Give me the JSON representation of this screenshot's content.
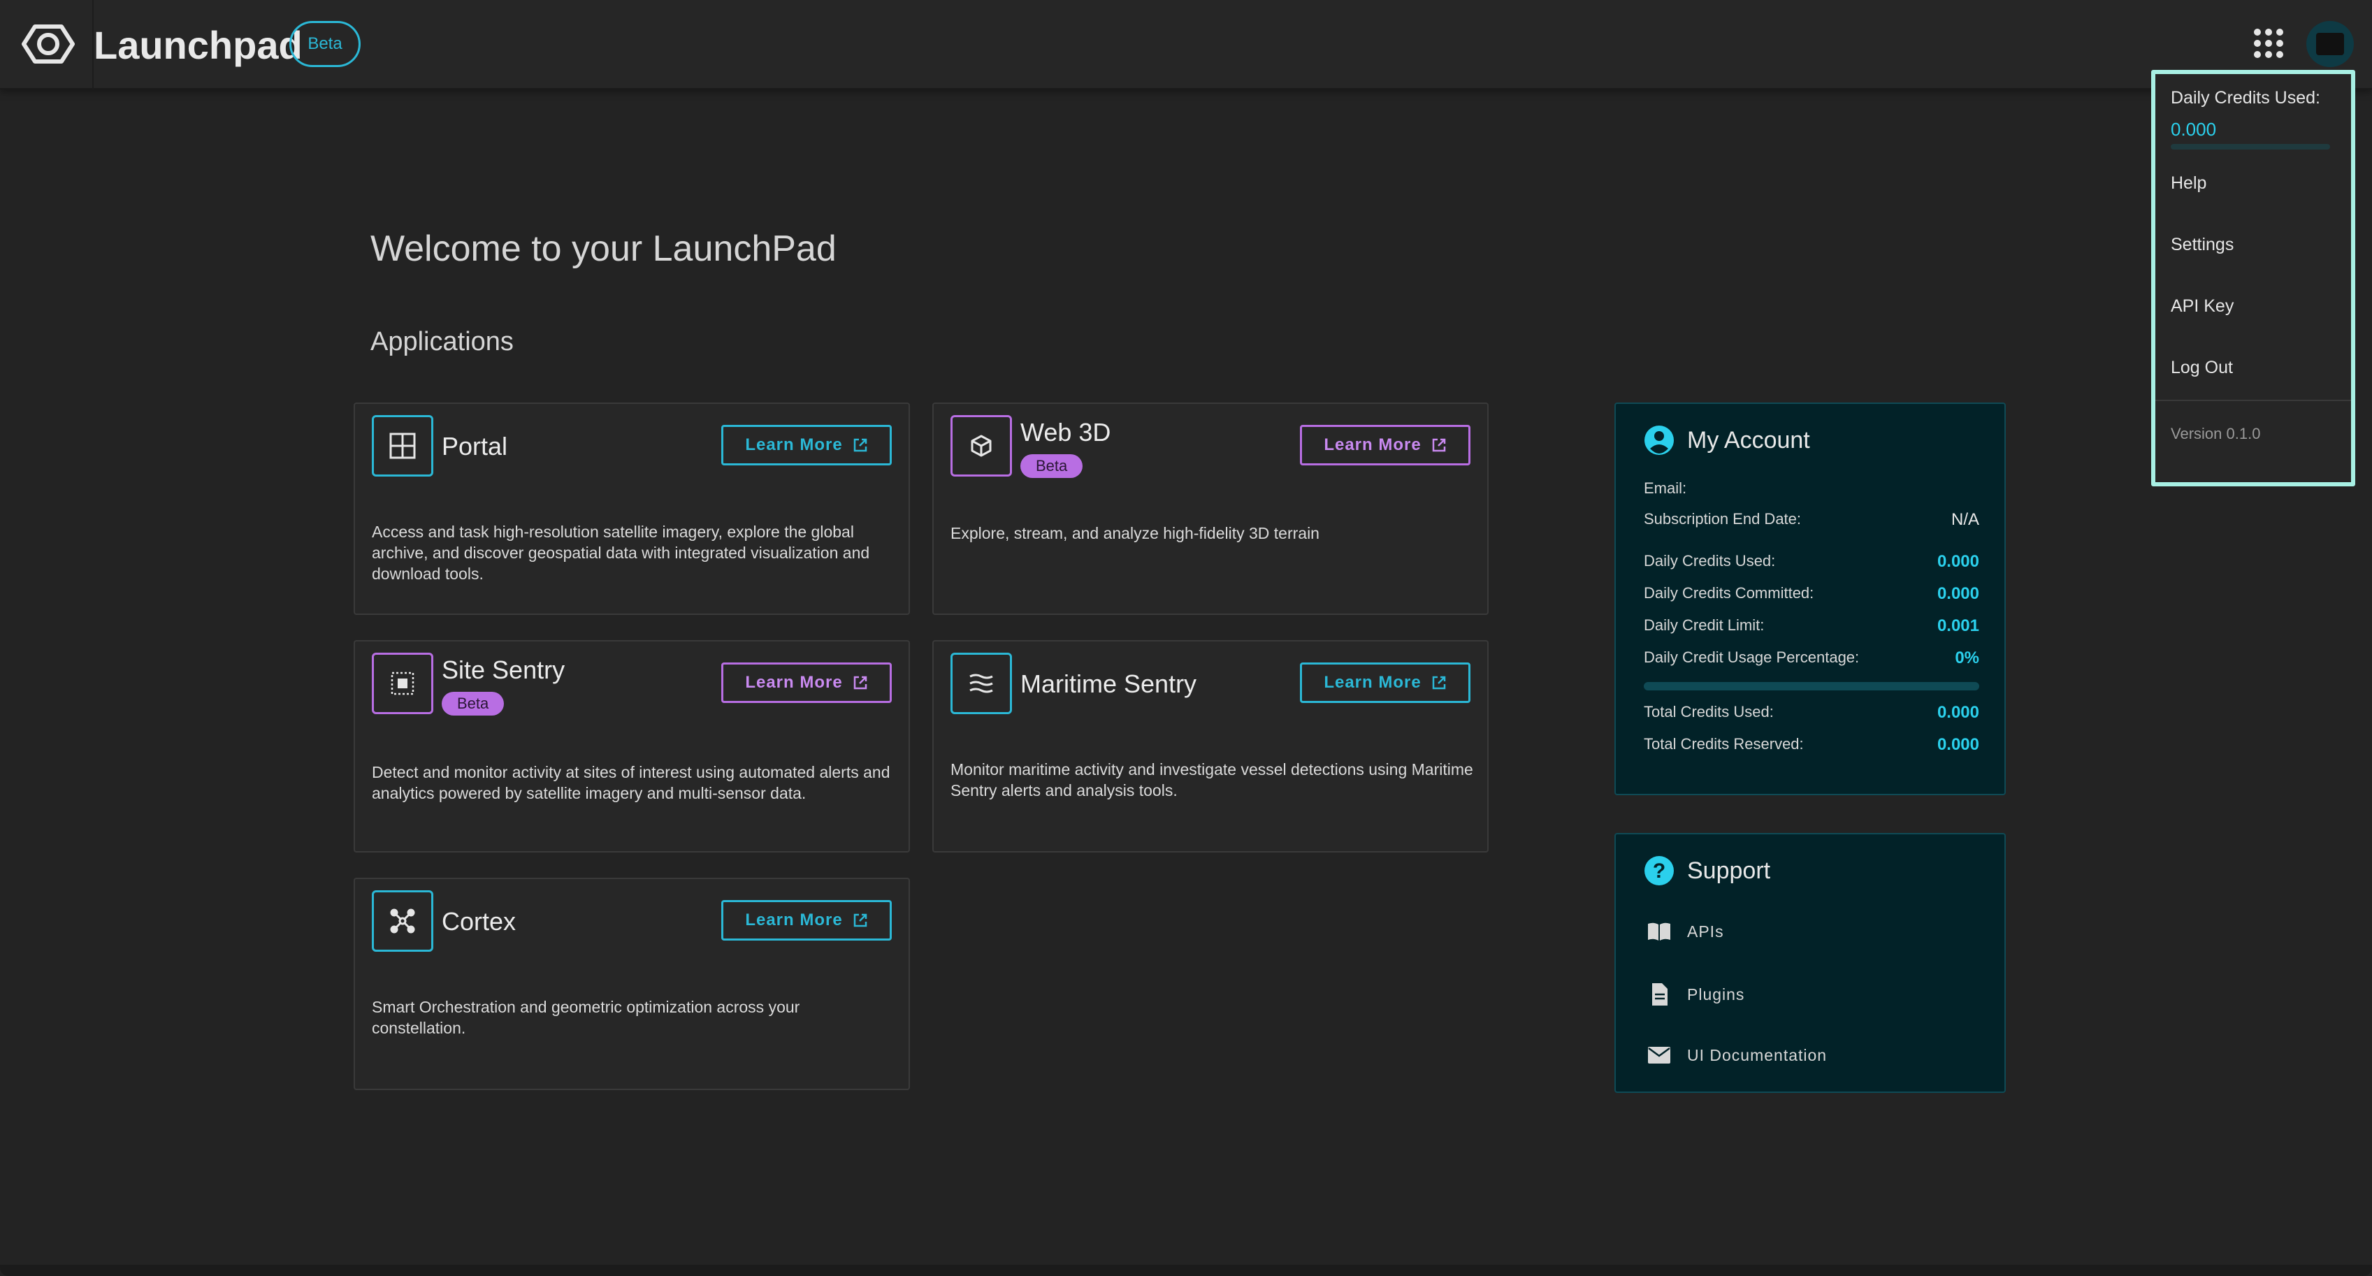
{
  "header": {
    "app_title": "Launchpad",
    "beta_label": "Beta",
    "logo_icon": "launchpad-logo",
    "apps_icon": "grid-icon",
    "avatar_icon": "user-avatar"
  },
  "main": {
    "welcome": "Welcome to your LaunchPad",
    "applications_title": "Applications"
  },
  "apps": [
    {
      "name": "Portal",
      "icon": "grid-window-icon",
      "learn_more": "Learn More",
      "description": "Access and task high-resolution satellite imagery, explore the global archive, and discover geospatial data with integrated visualization and download tools."
    },
    {
      "name": "Web 3D",
      "icon": "cube-icon",
      "badge": "Beta",
      "learn_more": "Learn More",
      "description": "Explore, stream, and analyze high-fidelity 3D terrain"
    },
    {
      "name": "Site Sentry",
      "icon": "target-grid-icon",
      "badge": "Beta",
      "learn_more": "Learn More",
      "description": "Detect and monitor activity at sites of interest using automated alerts and analytics powered by satellite imagery and multi-sensor data."
    },
    {
      "name": "Maritime Sentry",
      "icon": "waves-icon",
      "learn_more": "Learn More",
      "description": "Monitor maritime activity and investigate vessel detections using Maritime Sentry alerts and analysis tools."
    },
    {
      "name": "Cortex",
      "icon": "network-nodes-icon",
      "learn_more": "Learn More",
      "description": "Smart Orchestration and geometric optimization across your constellation."
    }
  ],
  "account": {
    "title": "My Account",
    "email_label": "Email:",
    "email_value": "",
    "subscription_label": "Subscription End Date:",
    "subscription_value": "N/A",
    "daily_used_label": "Daily Credits Used:",
    "daily_used_value": "0.000",
    "daily_committed_label": "Daily Credits Committed:",
    "daily_committed_value": "0.000",
    "daily_limit_label": "Daily Credit Limit:",
    "daily_limit_value": "0.001",
    "usage_pct_label": "Daily Credit Usage Percentage:",
    "usage_pct_value": "0%",
    "usage_fraction": 0,
    "total_used_label": "Total Credits Used:",
    "total_used_value": "0.000",
    "total_reserved_label": "Total Credits Reserved:",
    "total_reserved_value": "0.000"
  },
  "support": {
    "title": "Support",
    "links": [
      "APIs",
      "Plugins",
      "UI Documentation"
    ]
  },
  "dropdown": {
    "credits_label": "Daily Credits Used:",
    "credits_value": "0.000",
    "credits_fraction": 0,
    "items": [
      "Help",
      "Settings",
      "API Key",
      "Log Out"
    ],
    "version": "Version 0.1.0"
  },
  "colors": {
    "accent": "#2bb8d6",
    "beta": "#b86ee3",
    "panel_bg": "#022228",
    "dropdown_border": "#a8f0e4"
  }
}
